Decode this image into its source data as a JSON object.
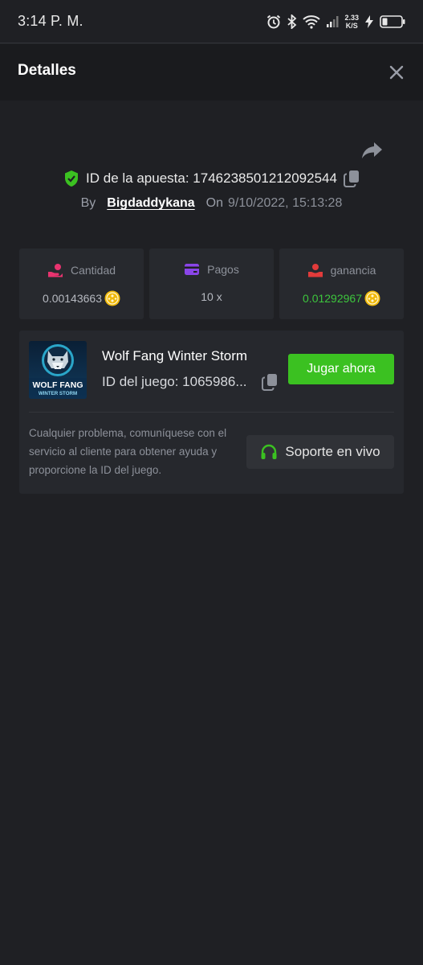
{
  "status_bar": {
    "time": "3:14 P. M.",
    "net_speed_value": "2.33",
    "net_speed_unit": "K/S",
    "icons": [
      "alarm-icon",
      "bluetooth-icon",
      "wifi-icon",
      "cellular-signal-icon",
      "charging-icon",
      "battery-icon"
    ]
  },
  "header": {
    "title": "Detalles",
    "close_icon": "close-icon"
  },
  "bet": {
    "id_text": "ID de la apuesta: 1746238501212092544",
    "by_label": "By",
    "username": "Bigdaddykana",
    "on_label": "On",
    "datetime": "9/10/2022, 15:13:28"
  },
  "stats": {
    "amount": {
      "label": "Cantidad",
      "value": "0.00143663",
      "icon": "hand-coins-icon"
    },
    "payout": {
      "label": "Pagos",
      "value": "10 x",
      "icon": "card-icon"
    },
    "profit": {
      "label": "ganancia",
      "value": "0.01292967",
      "icon": "profit-icon"
    }
  },
  "game": {
    "thumb_line1": "WOLF FANG",
    "thumb_line2": "WINTER STORM",
    "name": "Wolf Fang Winter Storm",
    "id_text": "ID del juego: 1065986...",
    "play_label": "Jugar ahora",
    "help_text": "Cualquier problema, comuníquese con el servicio al cliente para obtener ayuda y proporcione la ID del juego.",
    "support_label": "Soporte en vivo"
  },
  "colors": {
    "background": "#1f2024",
    "header": "#1a1b1e",
    "card": "#26282d",
    "accent_green": "#3bc121",
    "profit_green": "#3dc53d",
    "pink": "#e8336f",
    "purple": "#8a45e8",
    "red": "#e23b3b",
    "coin_gold": "#f0b90b"
  }
}
